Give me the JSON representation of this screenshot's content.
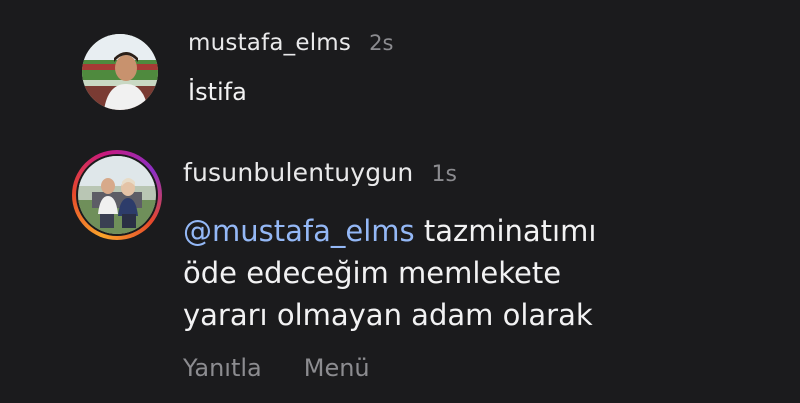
{
  "comments": [
    {
      "username": "mustafa_elms",
      "time": "2s",
      "text": "İstifa"
    },
    {
      "username": "fusunbulentuygun",
      "time": "1s",
      "mention": "@mustafa_elms",
      "lines": [
        " tazminatımı",
        "öde edeceğim memlekete",
        "yararı olmayan adam olarak"
      ],
      "actions": {
        "reply": "Yanıtla",
        "menu": "Menü"
      }
    }
  ],
  "colors": {
    "background": "#1b1b1d",
    "text": "#f2f2f3",
    "muted": "#8c8c90",
    "mention": "#94b8f6",
    "story_ring": [
      "#f9a42b",
      "#e6492b",
      "#c8197f",
      "#8d2fc5"
    ]
  }
}
